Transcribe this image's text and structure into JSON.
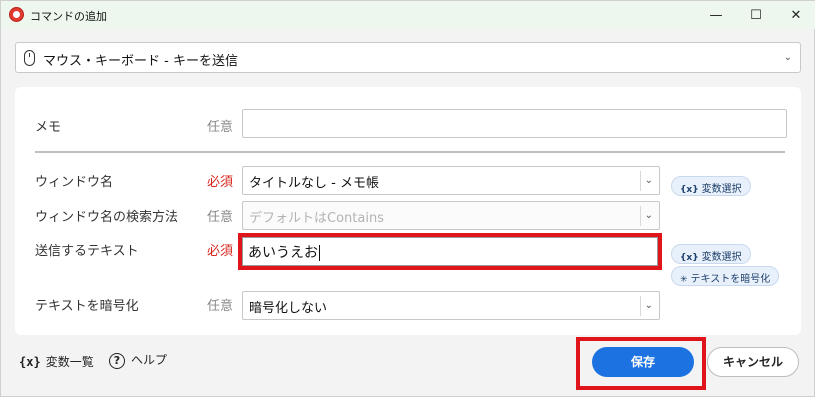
{
  "window": {
    "title": "コマンドの追加",
    "minimize_glyph": "—",
    "maximize_glyph": "☐",
    "close_glyph": "✕"
  },
  "command": {
    "selected": "マウス・キーボード - キーを送信",
    "icon": "mouse-icon"
  },
  "form": {
    "memo": {
      "label": "メモ",
      "requirement": "任意",
      "value": ""
    },
    "window_name": {
      "label": "ウィンドウ名",
      "requirement": "必須",
      "value": "タイトルなし - メモ帳"
    },
    "search_method": {
      "label": "ウィンドウ名の検索方法",
      "requirement": "任意",
      "placeholder": "デフォルトはContains"
    },
    "send_text": {
      "label": "送信するテキスト",
      "requirement": "必須",
      "value": "あいうえお"
    },
    "encrypt": {
      "label": "テキストを暗号化",
      "requirement": "任意",
      "value": "暗号化しない"
    }
  },
  "pills": {
    "var_select_1": {
      "icon": "{x}",
      "label": "変数選択"
    },
    "var_select_2": {
      "icon": "{x}",
      "label": "変数選択"
    },
    "encrypt_text": {
      "icon": "✳",
      "label": "テキストを暗号化"
    }
  },
  "footer": {
    "var_list": {
      "icon": "{x}",
      "label": "変数一覧"
    },
    "help": {
      "icon": "?",
      "label": "ヘルプ"
    },
    "save_label": "保存",
    "cancel_label": "キャンセル"
  },
  "colors": {
    "accent": "#1b72e0",
    "required": "#d9261c",
    "highlight": "#e0141b",
    "titlebar": "#eef7ee"
  }
}
